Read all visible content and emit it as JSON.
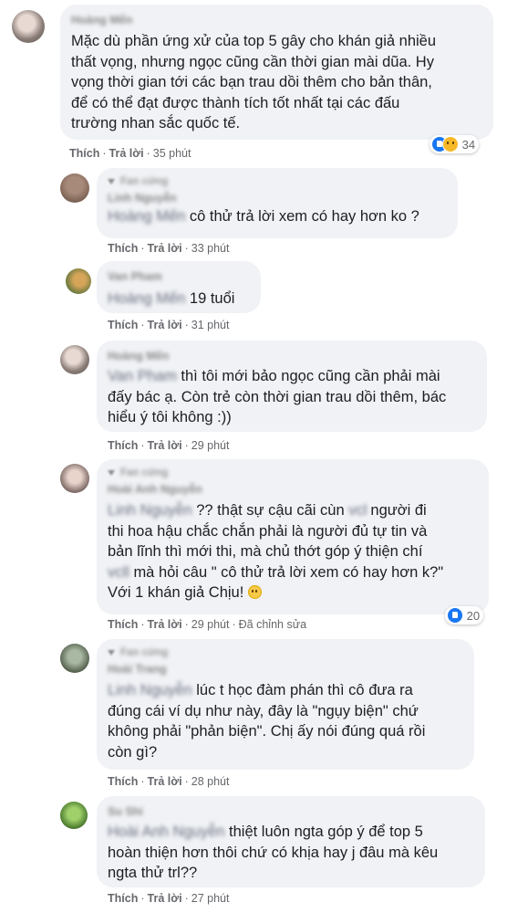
{
  "labels": {
    "like": "Thích",
    "reply": "Trả lời",
    "sep": "·"
  },
  "comments": [
    {
      "id": "c1",
      "name": "Hoàng Mến",
      "lines": [
        "Mặc dù phần ứng xử của top 5 gây cho khán giả nhiều",
        "thất vọng, nhưng ngọc cũng cần thời gian mài dũa. Hy",
        "vọng thời gian tới các bạn trau dồi thêm cho bản thân,",
        "để có thể đạt được thành tích tốt nhất tại các đấu",
        "trường nhan sắc quốc tế."
      ],
      "time": "35 phút",
      "reactions": {
        "count": "34",
        "icons": [
          "like-icon",
          "sad-icon"
        ]
      }
    },
    {
      "id": "c2",
      "tag": "Fan cứng",
      "name": "Linh Nguyễn",
      "mention": "Hoàng Mến",
      "lines": [
        "cô thử trả lời xem có hay hơn ko ?"
      ],
      "time": "33 phút"
    },
    {
      "id": "c3",
      "name": "Van Pham",
      "mention": "Hoàng Mến",
      "lines": [
        "19 tuổi"
      ],
      "time": "31 phút"
    },
    {
      "id": "c4",
      "name": "Hoàng Mến",
      "mention": "Van Pham",
      "lines": [
        "thì tôi mới bảo ngọc cũng cần phải mài",
        "đấy bác ạ. Còn trẻ còn thời gian trau dồi thêm, bác",
        "hiểu ý tôi không :))"
      ],
      "time": "29 phút"
    },
    {
      "id": "c5",
      "tag": "Fan cứng",
      "name": "Hoài Anh Nguyễn",
      "mention": "Linh Nguyễn",
      "lines": [
        "?? thật sự cậu cãi cùn",
        "người đi",
        "thi hoa hậu chắc chắn phải là người đủ tự tin và",
        "bản lĩnh thì mới thi, mà chủ thớt góp ý thiện chí",
        "mà hỏi câu \" cô thử trả lời xem có hay hơn k?\"",
        "Với 1 khán giả Chịu!"
      ],
      "censor1": "vcl",
      "censor2": "vcll",
      "time": "29 phút",
      "edited": "Đã chỉnh sửa",
      "reactions": {
        "count": "20",
        "icons": [
          "like-icon"
        ]
      }
    },
    {
      "id": "c6",
      "tag": "Fan cứng",
      "name": "Hoài Trang",
      "mention": "Linh Nguyễn",
      "lines": [
        "lúc t học đàm phán thì cô đưa ra",
        "đúng cái ví dụ như này, đây là \"ngụy biện\" chứ",
        "không phải \"phản biện\". Chị ấy nói đúng quá rồi",
        "còn gì?"
      ],
      "time": "28 phút"
    },
    {
      "id": "c7",
      "name": "Su Shi",
      "mention": "Hoài Anh Nguyễn",
      "lines": [
        "thiệt luôn ngta góp ý để top 5",
        "hoàn thiện hơn thôi chứ có khịa hay j đâu mà kêu",
        "ngta thử trl??"
      ],
      "time": "27 phút"
    }
  ]
}
